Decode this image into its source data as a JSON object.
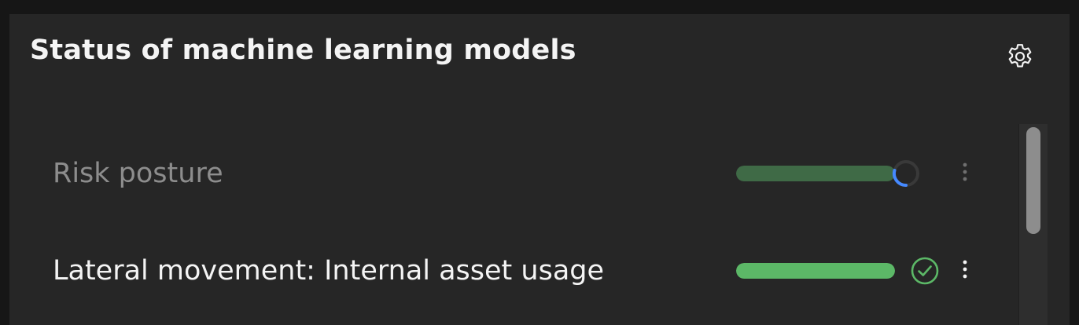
{
  "panel": {
    "title": "Status of machine learning models",
    "settings_icon": "gear-icon"
  },
  "models": [
    {
      "label": "Risk posture",
      "progress": 1.0,
      "status": "loading",
      "status_icon": "loading-spinner-icon",
      "menu_icon": "overflow-menu-icon",
      "disabled": true
    },
    {
      "label": "Lateral movement: Internal asset usage",
      "progress": 1.0,
      "status": "complete",
      "status_icon": "checkmark-circle-icon",
      "menu_icon": "overflow-menu-icon",
      "disabled": false
    }
  ],
  "colors": {
    "panel_bg": "#262626",
    "page_bg": "#161616",
    "text_primary": "#f4f4f4",
    "text_disabled": "#8d8d8d",
    "progress_success": "#5cb867",
    "progress_dim": "#3f6a46",
    "spinner": "#4589ff"
  }
}
